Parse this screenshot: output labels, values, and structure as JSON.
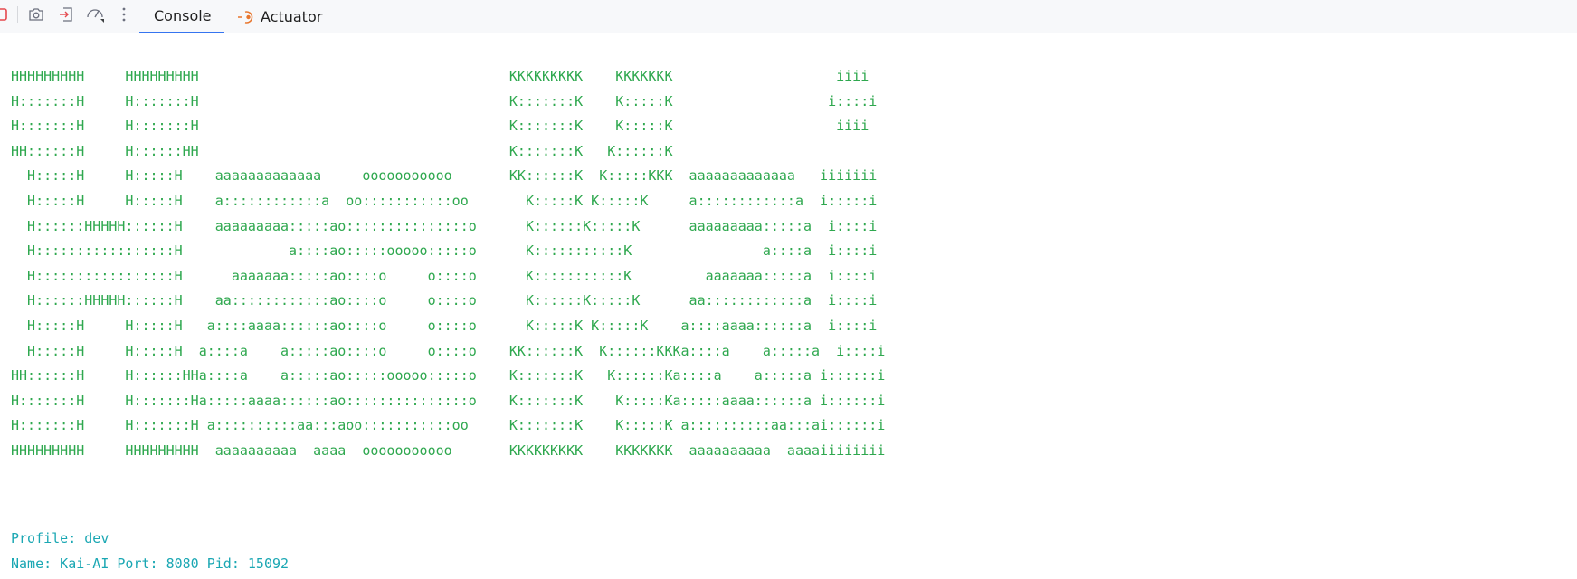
{
  "toolbar": {
    "icons": [
      "stop-icon",
      "camera-icon",
      "login-icon",
      "gauge-icon",
      "more-icon"
    ],
    "tabs": [
      {
        "label": "Console",
        "active": true
      },
      {
        "label": "Actuator",
        "active": false
      }
    ],
    "colors": {
      "accent": "#3574f0",
      "actuator_icon": "#e8762d",
      "stop": "#e5484d"
    }
  },
  "console": {
    "banner_color": "#2fa84f",
    "info_color": "#1aa7b3",
    "banner": [
      "HHHHHHHHH     HHHHHHHHH                                      KKKKKKKKK    KKKKKKK                    iiii",
      "H:::::::H     H:::::::H                                      K:::::::K    K:::::K                   i::::i",
      "H:::::::H     H:::::::H                                      K:::::::K    K:::::K                    iiii",
      "HH::::::H     H::::::HH                                      K:::::::K   K::::::K",
      "  H:::::H     H:::::H    aaaaaaaaaaaaa     ooooooooooo       KK::::::K  K:::::KKK  aaaaaaaaaaaaa   iiiiiii",
      "  H:::::H     H:::::H    a::::::::::::a  oo:::::::::::oo       K:::::K K:::::K     a::::::::::::a  i:::::i",
      "  H::::::HHHHH::::::H    aaaaaaaaa:::::ao:::::::::::::::o      K::::::K:::::K      aaaaaaaaa:::::a  i::::i",
      "  H:::::::::::::::::H             a::::ao:::::ooooo:::::o      K:::::::::::K                a::::a  i::::i",
      "  H:::::::::::::::::H      aaaaaaa:::::ao::::o     o::::o      K:::::::::::K         aaaaaaa:::::a  i::::i",
      "  H::::::HHHHH::::::H    aa::::::::::::ao::::o     o::::o      K::::::K:::::K      aa::::::::::::a  i::::i",
      "  H:::::H     H:::::H   a::::aaaa::::::ao::::o     o::::o      K:::::K K:::::K    a::::aaaa::::::a  i::::i",
      "  H:::::H     H:::::H  a::::a    a:::::ao::::o     o::::o    KK::::::K  K::::::KKKa::::a    a:::::a  i::::i",
      "HH::::::H     H::::::HHa::::a    a:::::ao:::::ooooo:::::o    K:::::::K   K::::::Ka::::a    a:::::a i::::::i",
      "H:::::::H     H:::::::Ha:::::aaaa::::::ao:::::::::::::::o    K:::::::K    K:::::Ka:::::aaaa::::::a i::::::i",
      "H:::::::H     H:::::::H a::::::::::aa:::aoo:::::::::::oo     K:::::::K    K:::::K a::::::::::aa:::ai::::::i",
      "HHHHHHHHH     HHHHHHHHH  aaaaaaaaaa  aaaa  ooooooooooo       KKKKKKKKK    KKKKKKK  aaaaaaaaaa  aaaaiiiiiiii"
    ],
    "info": [
      "Profile: dev",
      "Name: Kai-AI Port: 8080 Pid: 15092"
    ]
  }
}
